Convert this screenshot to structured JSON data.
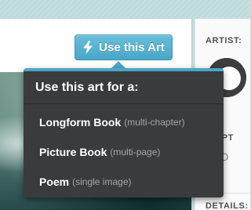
{
  "toolbar": {
    "use_art_button": {
      "label": "Use this Art",
      "icon": "lightning-bolt-icon"
    }
  },
  "dropdown": {
    "header": "Use this art for a:",
    "items": [
      {
        "label": "Longform Book",
        "note": "(multi-chapter)"
      },
      {
        "label": "Picture Book",
        "note": "(multi-page)"
      },
      {
        "label": "Poem",
        "note": "(single image)"
      }
    ]
  },
  "sidebar": {
    "artist_label": "ARTIST:",
    "description_label_partial": "CRIPT",
    "description_text_partial": "ers D",
    "details_label": "DETAILS:"
  },
  "colors": {
    "accent": "#4aa6c6",
    "dropdown_bg": "#3a3b3d",
    "page_bg": "#c4dfe0"
  }
}
